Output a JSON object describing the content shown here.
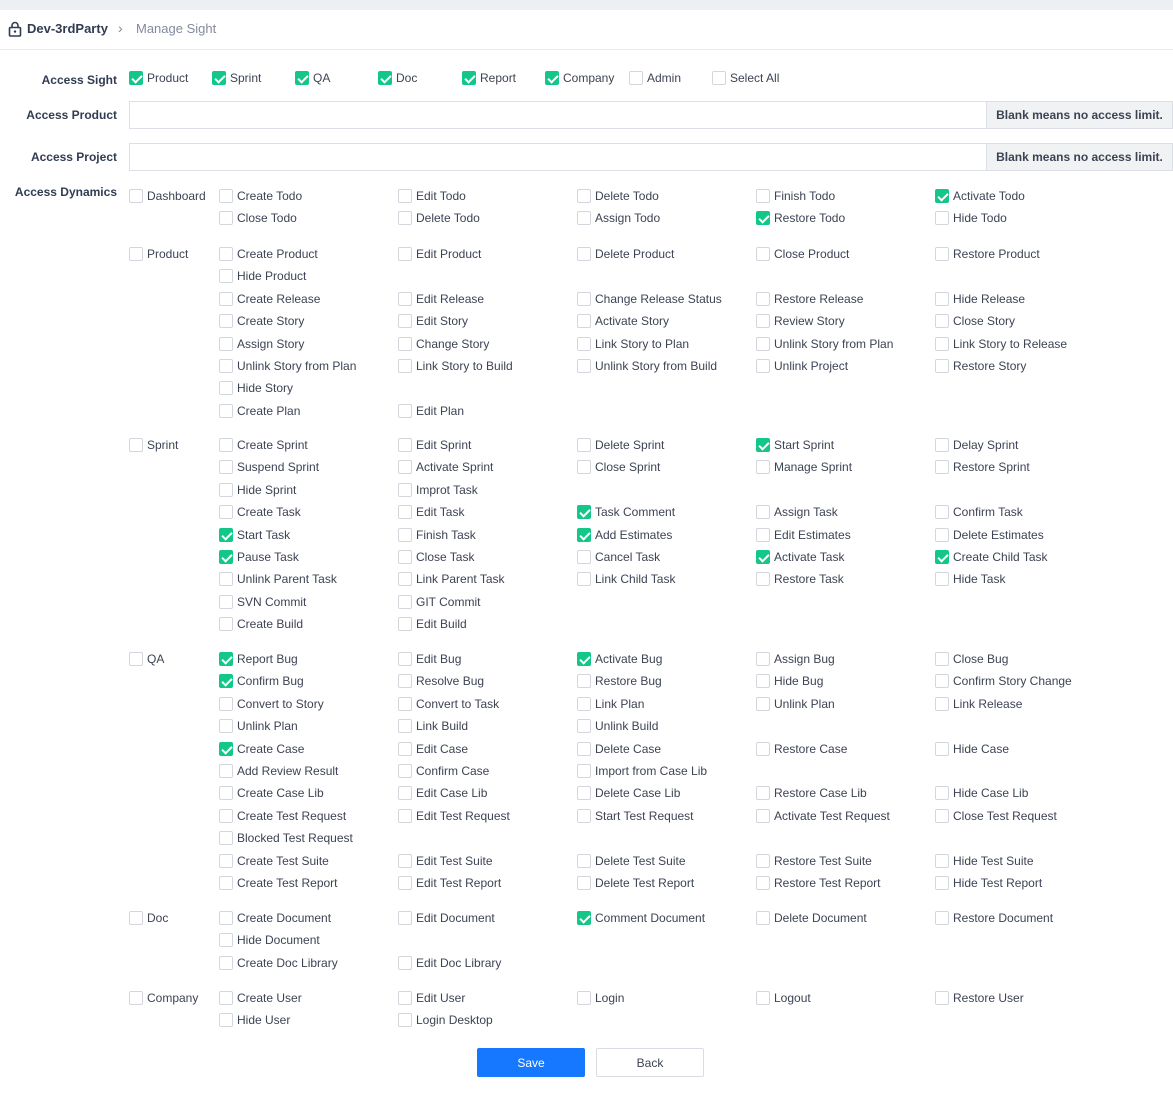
{
  "breadcrumb": {
    "root": "Dev-3rdParty",
    "current": "Manage Sight"
  },
  "labels": {
    "access_sight": "Access Sight",
    "access_product": "Access Product",
    "access_project": "Access Project",
    "access_dynamics": "Access Dynamics"
  },
  "access_sight": [
    {
      "label": "Product",
      "checked": true
    },
    {
      "label": "Sprint",
      "checked": true
    },
    {
      "label": "QA",
      "checked": true
    },
    {
      "label": "Doc",
      "checked": true
    },
    {
      "label": "Report",
      "checked": true
    },
    {
      "label": "Company",
      "checked": true
    },
    {
      "label": "Admin",
      "checked": false
    },
    {
      "label": "Select All",
      "checked": false
    }
  ],
  "access_product": {
    "value": "",
    "addon": "Blank means no access limit."
  },
  "access_project": {
    "value": "",
    "addon": "Blank means no access limit."
  },
  "groups": [
    {
      "name": "Dashboard",
      "checked": false,
      "rows": [
        [
          [
            "Create Todo",
            false
          ],
          [
            "Edit Todo",
            false
          ],
          [
            "Delete Todo",
            false
          ],
          [
            "Finish Todo",
            false
          ],
          [
            "Activate Todo",
            true
          ]
        ],
        [
          [
            "Close Todo",
            false
          ],
          [
            "Delete Todo",
            false
          ],
          [
            "Assign Todo",
            false
          ],
          [
            "Restore Todo",
            true
          ],
          [
            "Hide Todo",
            false
          ]
        ]
      ]
    },
    {
      "name": "Product",
      "checked": false,
      "rows": [
        [
          [
            "Create Product",
            false
          ],
          [
            "Edit Product",
            false
          ],
          [
            "Delete Product",
            false
          ],
          [
            "Close Product",
            false
          ],
          [
            "Restore Product",
            false
          ]
        ],
        [
          [
            "Hide Product",
            false
          ]
        ],
        [
          [
            "Create Release",
            false
          ],
          [
            "Edit Release",
            false
          ],
          [
            "Change Release Status",
            false
          ],
          [
            "Restore Release",
            false
          ],
          [
            "Hide Release",
            false
          ]
        ],
        [
          [
            "Create Story",
            false
          ],
          [
            "Edit Story",
            false
          ],
          [
            "Activate Story",
            false
          ],
          [
            "Review Story",
            false
          ],
          [
            "Close Story",
            false
          ]
        ],
        [
          [
            "Assign Story",
            false
          ],
          [
            "Change Story",
            false
          ],
          [
            "Link Story to Plan",
            false
          ],
          [
            "Unlink Story from Plan",
            false
          ],
          [
            "Link Story to Release",
            false
          ]
        ],
        [
          [
            "Unlink Story from Plan",
            false
          ],
          [
            "Link Story to Build",
            false
          ],
          [
            "Unlink Story from Build",
            false
          ],
          [
            "Unlink Project",
            false
          ],
          [
            "Restore Story",
            false
          ]
        ],
        [
          [
            "Hide Story",
            false
          ]
        ],
        [
          [
            "Create Plan",
            false
          ],
          [
            "Edit Plan",
            false
          ]
        ]
      ]
    },
    {
      "name": "Sprint",
      "checked": false,
      "rows": [
        [
          [
            "Create Sprint",
            false
          ],
          [
            "Edit Sprint",
            false
          ],
          [
            "Delete Sprint",
            false
          ],
          [
            "Start Sprint",
            true
          ],
          [
            "Delay Sprint",
            false
          ]
        ],
        [
          [
            "Suspend Sprint",
            false
          ],
          [
            "Activate Sprint",
            false
          ],
          [
            "Close Sprint",
            false
          ],
          [
            "Manage Sprint",
            false
          ],
          [
            "Restore Sprint",
            false
          ]
        ],
        [
          [
            "Hide Sprint",
            false
          ],
          [
            "Improt Task",
            false
          ]
        ],
        [
          [
            "Create Task",
            false
          ],
          [
            "Edit Task",
            false
          ],
          [
            "Task Comment",
            true
          ],
          [
            "Assign Task",
            false
          ],
          [
            "Confirm Task",
            false
          ]
        ],
        [
          [
            "Start Task",
            true
          ],
          [
            "Finish Task",
            false
          ],
          [
            "Add Estimates",
            true
          ],
          [
            "Edit Estimates",
            false
          ],
          [
            "Delete Estimates",
            false
          ]
        ],
        [
          [
            "Pause Task",
            true
          ],
          [
            "Close Task",
            false
          ],
          [
            "Cancel Task",
            false
          ],
          [
            "Activate Task",
            true
          ],
          [
            "Create Child Task",
            true
          ]
        ],
        [
          [
            "Unlink Parent Task",
            false
          ],
          [
            "Link Parent Task",
            false
          ],
          [
            "Link Child Task",
            false
          ],
          [
            "Restore Task",
            false
          ],
          [
            "Hide Task",
            false
          ]
        ],
        [
          [
            "SVN Commit",
            false
          ],
          [
            "GIT Commit",
            false
          ]
        ],
        [
          [
            "Create Build",
            false
          ],
          [
            "Edit Build",
            false
          ]
        ]
      ]
    },
    {
      "name": "QA",
      "checked": false,
      "rows": [
        [
          [
            "Report Bug",
            true
          ],
          [
            "Edit Bug",
            false
          ],
          [
            "Activate Bug",
            true
          ],
          [
            "Assign Bug",
            false
          ],
          [
            "Close Bug",
            false
          ]
        ],
        [
          [
            "Confirm Bug",
            true
          ],
          [
            "Resolve Bug",
            false
          ],
          [
            "Restore Bug",
            false
          ],
          [
            "Hide Bug",
            false
          ],
          [
            "Confirm Story Change",
            false
          ]
        ],
        [
          [
            "Convert to Story",
            false
          ],
          [
            "Convert to Task",
            false
          ],
          [
            "Link Plan",
            false
          ],
          [
            "Unlink Plan",
            false
          ],
          [
            "Link Release",
            false
          ]
        ],
        [
          [
            "Unlink Plan",
            false
          ],
          [
            "Link Build",
            false
          ],
          [
            "Unlink Build",
            false
          ]
        ],
        [
          [
            "Create Case",
            true
          ],
          [
            "Edit Case",
            false
          ],
          [
            "Delete Case",
            false
          ],
          [
            "Restore Case",
            false
          ],
          [
            "Hide Case",
            false
          ]
        ],
        [
          [
            "Add Review Result",
            false
          ],
          [
            "Confirm Case",
            false
          ],
          [
            "Import from Case Lib",
            false
          ]
        ],
        [
          [
            "Create Case Lib",
            false
          ],
          [
            "Edit Case Lib",
            false
          ],
          [
            "Delete Case Lib",
            false
          ],
          [
            "Restore Case Lib",
            false
          ],
          [
            "Hide Case Lib",
            false
          ]
        ],
        [
          [
            "Create Test Request",
            false
          ],
          [
            "Edit Test Request",
            false
          ],
          [
            "Start Test Request",
            false
          ],
          [
            "Activate Test Request",
            false
          ],
          [
            "Close Test Request",
            false
          ]
        ],
        [
          [
            "Blocked Test Request",
            false
          ]
        ],
        [
          [
            "Create Test Suite",
            false
          ],
          [
            "Edit Test Suite",
            false
          ],
          [
            "Delete Test Suite",
            false
          ],
          [
            "Restore Test Suite",
            false
          ],
          [
            "Hide Test Suite",
            false
          ]
        ],
        [
          [
            "Create Test Report",
            false
          ],
          [
            "Edit Test Report",
            false
          ],
          [
            "Delete Test Report",
            false
          ],
          [
            "Restore Test Report",
            false
          ],
          [
            "Hide Test Report",
            false
          ]
        ]
      ]
    },
    {
      "name": "Doc",
      "checked": false,
      "rows": [
        [
          [
            "Create Document",
            false
          ],
          [
            "Edit Document",
            false
          ],
          [
            "Comment Document",
            true
          ],
          [
            "Delete Document",
            false
          ],
          [
            "Restore Document",
            false
          ]
        ],
        [
          [
            "Hide Document",
            false
          ]
        ],
        [
          [
            "Create Doc Library",
            false
          ],
          [
            "Edit Doc Library",
            false
          ]
        ]
      ]
    },
    {
      "name": "Company",
      "checked": false,
      "rows": [
        [
          [
            "Create User",
            false
          ],
          [
            "Edit User",
            false
          ],
          [
            "Login",
            false
          ],
          [
            "Logout",
            false
          ],
          [
            "Restore User",
            false
          ]
        ],
        [
          [
            "Hide User",
            false
          ],
          [
            "Login Desktop",
            false
          ]
        ]
      ]
    }
  ],
  "buttons": {
    "save": "Save",
    "back": "Back"
  },
  "colors": {
    "check": "#12c787",
    "primary": "#1677ff"
  }
}
